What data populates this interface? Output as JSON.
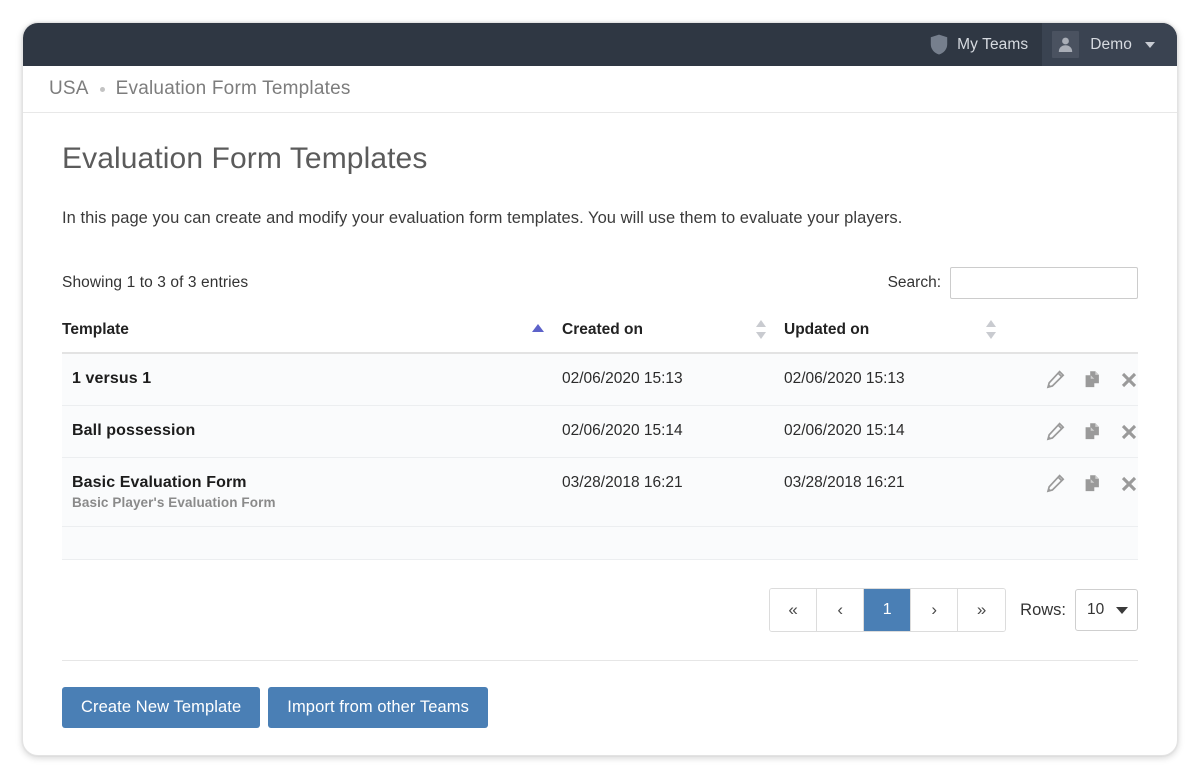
{
  "navbar": {
    "my_teams_label": "My Teams",
    "user_label": "Demo",
    "shield_icon": "shield-icon",
    "avatar_icon": "user-avatar-icon",
    "caret_icon": "chevron-down-icon",
    "background_color": "#2f3743"
  },
  "breadcrumb": {
    "root": "USA",
    "current": "Evaluation Form Templates"
  },
  "page": {
    "title": "Evaluation Form Templates",
    "description": "In this page you can create and modify your evaluation form templates. You will use them to evaluate your players."
  },
  "table_toolbar": {
    "showing_info": "Showing 1 to 3 of 3 entries",
    "search_label": "Search:",
    "search_value": "",
    "search_placeholder": ""
  },
  "table": {
    "columns": [
      {
        "label": "Template",
        "sort": "asc"
      },
      {
        "label": "Created on",
        "sort": "none"
      },
      {
        "label": "Updated on",
        "sort": "none"
      },
      {
        "label": "",
        "sort": "none"
      }
    ],
    "rows": [
      {
        "name": "1 versus 1",
        "subtitle": "",
        "created_on": "02/06/2020 15:13",
        "updated_on": "02/06/2020 15:13"
      },
      {
        "name": "Ball possession",
        "subtitle": "",
        "created_on": "02/06/2020 15:14",
        "updated_on": "02/06/2020 15:14"
      },
      {
        "name": "Basic Evaluation Form",
        "subtitle": "Basic Player's Evaluation Form",
        "created_on": "03/28/2018 16:21",
        "updated_on": "03/28/2018 16:21"
      }
    ],
    "row_actions": {
      "edit_icon": "pencil-icon",
      "duplicate_icon": "copy-icon",
      "delete_icon": "close-x-icon"
    }
  },
  "pagination": {
    "first_label": "«",
    "prev_label": "‹",
    "pages": [
      "1"
    ],
    "current_page": "1",
    "next_label": "›",
    "last_label": "»",
    "rows_label": "Rows:",
    "rows_value": "10",
    "active_color": "#4a7fb5"
  },
  "footer": {
    "create_button": "Create New Template",
    "import_button": "Import from other Teams",
    "button_color": "#4a7fb5"
  }
}
